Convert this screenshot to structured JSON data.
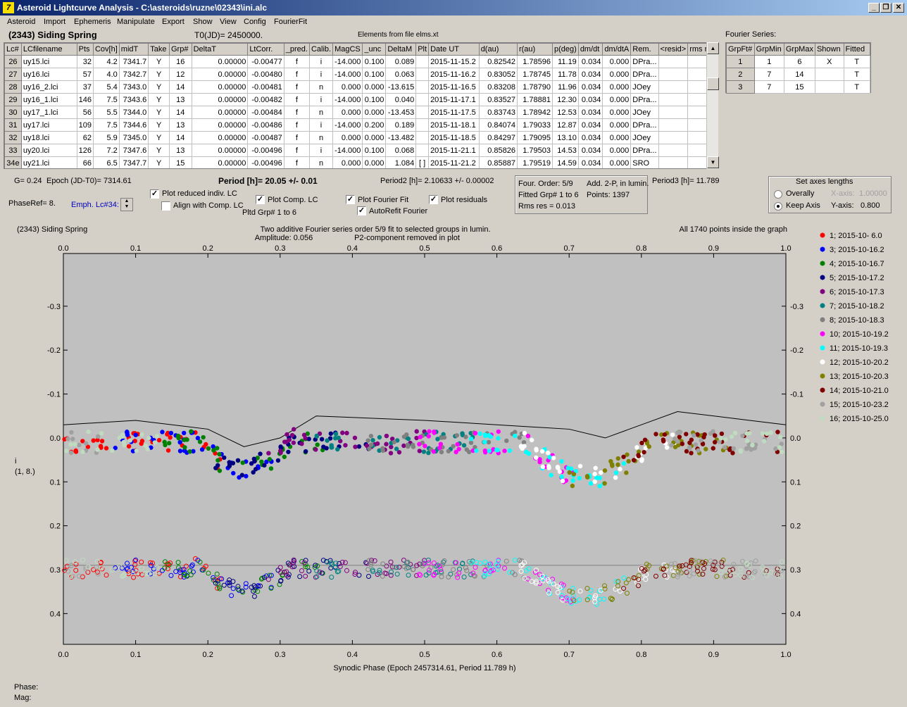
{
  "window": {
    "title": "Asteroid Lightcurve Analysis - C:\\asteroids\\ruzne\\02343\\ini.alc",
    "app_icon": "7"
  },
  "menu": [
    "Asteroid",
    "Import",
    "Ephemeris",
    "Manipulate",
    "Export",
    "Show",
    "View",
    "Config",
    "FourierFit"
  ],
  "header": {
    "object_name": "(2343) Siding Spring",
    "t0": "T0(JD)= 2450000.",
    "elements": "Elements from file elms.xt"
  },
  "table": {
    "columns": [
      "Lc#",
      "LCfilename",
      "Pts",
      "Cov[h]",
      "midT",
      "Take",
      "Grp#",
      "DeltaT",
      "LtCorr.",
      "_pred.",
      "Calib.",
      "MagCS",
      "_unc",
      "DeltaM",
      "Plt",
      "Date UT",
      "d(au)",
      "r(au)",
      "p(deg)",
      "dm/dt",
      "dm/dtA",
      "Rem.",
      "<resid>",
      "rms res"
    ],
    "rows": [
      [
        "26",
        "uy15.lci",
        "32",
        "4.2",
        "7341.7",
        "Y",
        "16",
        "0.00000",
        "-0.00477",
        "f",
        "i",
        "-14.000",
        "0.100",
        "0.089",
        "",
        "2015-11-15.2",
        "0.82542",
        "1.78596",
        "11.19",
        "0.034",
        "0.000",
        "DPra...",
        "",
        ""
      ],
      [
        "27",
        "uy16.lci",
        "57",
        "4.0",
        "7342.7",
        "Y",
        "12",
        "0.00000",
        "-0.00480",
        "f",
        "i",
        "-14.000",
        "0.100",
        "0.063",
        "",
        "2015-11-16.2",
        "0.83052",
        "1.78745",
        "11.78",
        "0.034",
        "0.000",
        "DPra...",
        "",
        ""
      ],
      [
        "28",
        "uy16_2.lci",
        "37",
        "5.4",
        "7343.0",
        "Y",
        "14",
        "0.00000",
        "-0.00481",
        "f",
        "n",
        "0.000",
        "0.000",
        "-13.615",
        "",
        "2015-11-16.5",
        "0.83208",
        "1.78790",
        "11.96",
        "0.034",
        "0.000",
        "JOey",
        "",
        ""
      ],
      [
        "29",
        "uy16_1.lci",
        "146",
        "7.5",
        "7343.6",
        "Y",
        "13",
        "0.00000",
        "-0.00482",
        "f",
        "i",
        "-14.000",
        "0.100",
        "0.040",
        "",
        "2015-11-17.1",
        "0.83527",
        "1.78881",
        "12.30",
        "0.034",
        "0.000",
        "DPra...",
        "",
        ""
      ],
      [
        "30",
        "uy17_1.lci",
        "56",
        "5.5",
        "7344.0",
        "Y",
        "14",
        "0.00000",
        "-0.00484",
        "f",
        "n",
        "0.000",
        "0.000",
        "-13.453",
        "",
        "2015-11-17.5",
        "0.83743",
        "1.78942",
        "12.53",
        "0.034",
        "0.000",
        "JOey",
        "",
        ""
      ],
      [
        "31",
        "uy17.lci",
        "109",
        "7.5",
        "7344.6",
        "Y",
        "13",
        "0.00000",
        "-0.00486",
        "f",
        "i",
        "-14.000",
        "0.200",
        "0.189",
        "",
        "2015-11-18.1",
        "0.84074",
        "1.79033",
        "12.87",
        "0.034",
        "0.000",
        "DPra...",
        "",
        ""
      ],
      [
        "32",
        "uy18.lci",
        "62",
        "5.9",
        "7345.0",
        "Y",
        "14",
        "0.00000",
        "-0.00487",
        "f",
        "n",
        "0.000",
        "0.000",
        "-13.482",
        "",
        "2015-11-18.5",
        "0.84297",
        "1.79095",
        "13.10",
        "0.034",
        "0.000",
        "JOey",
        "",
        ""
      ],
      [
        "33",
        "uy20.lci",
        "126",
        "7.2",
        "7347.6",
        "Y",
        "13",
        "0.00000",
        "-0.00496",
        "f",
        "i",
        "-14.000",
        "0.100",
        "0.068",
        "",
        "2015-11-21.1",
        "0.85826",
        "1.79503",
        "14.53",
        "0.034",
        "0.000",
        "DPra...",
        "",
        ""
      ],
      [
        "34e",
        "uy21.lci",
        "66",
        "6.5",
        "7347.7",
        "Y",
        "15",
        "0.00000",
        "-0.00496",
        "f",
        "n",
        "0.000",
        "0.000",
        "1.084",
        "[ ]",
        "2015-11-21.2",
        "0.85887",
        "1.79519",
        "14.59",
        "0.034",
        "0.000",
        "SRO",
        "",
        ""
      ]
    ]
  },
  "fourier_table": {
    "title": "Fourier Series:",
    "columns": [
      "GrpFt#",
      "GrpMin",
      "GrpMax",
      "Shown",
      "Fitted"
    ],
    "rows": [
      [
        "1",
        "1",
        "6",
        "X",
        "T"
      ],
      [
        "2",
        "7",
        "14",
        "",
        "T"
      ],
      [
        "3",
        "7",
        "15",
        "",
        "T"
      ]
    ]
  },
  "info": {
    "g": "G= 0.24",
    "epoch": "Epoch (JD-T0)= 7314.61",
    "period": "Period [h]= 20.05 +/- 0.01",
    "period2": "Period2 [h]= 2.10633 +/- 0.00002",
    "period3": "Period3 [h]= 11.789",
    "phaseref": "PhaseRef= 8.",
    "emph": "Emph. Lc#34:",
    "plot_reduced": "Plot reduced indiv. LC",
    "align_comp": "Align with Comp. LC",
    "plot_comp": "Plot Comp. LC",
    "pltd_grp": "Pltd Grp#  1   to   6",
    "plot_fourier": "Plot Fourier Fit",
    "autorefit": "AutoRefit Fourier",
    "plot_resid": "Plot residuals",
    "four_order": "Four. Order:  5/9",
    "add2p": "Add. 2-P, in lumin.",
    "fitted_grp": "Fitted Grp# 1 to 6",
    "points": "Points: 1397",
    "rms": "Rms res     = 0.013"
  },
  "axes_box": {
    "title": "Set axes lengths",
    "overally": "Overally",
    "keep": "Keep Axis",
    "xaxis_label": "X-axis:",
    "xaxis_value": "1.00000",
    "yaxis_label": "Y-axis:",
    "yaxis_value": "0.800"
  },
  "plot": {
    "title_left": "(2343) Siding Spring",
    "title_center1": "Two additive Fourier series order 5/9 fit to selected groups in lumin.",
    "title_center2a": "Amplitude: 0.056",
    "title_center2b": "P2-component removed in plot",
    "title_right": "All 1740 points inside the graph",
    "ylabel1": "i",
    "ylabel2": "(1, 8.)",
    "xlabel": "Synodic Phase (Epoch 2457314.61, Period 11.789 h)",
    "bg_color": "#c0c0c0"
  },
  "chart_data": {
    "type": "scatter",
    "xlim": [
      0.0,
      1.0
    ],
    "ylim": [
      -0.42,
      0.47
    ],
    "y_inverted": true,
    "x_ticks": [
      "0.0",
      "0.1",
      "0.2",
      "0.3",
      "0.4",
      "0.5",
      "0.6",
      "0.7",
      "0.8",
      "0.9",
      "1.0"
    ],
    "y_ticks": [
      "-0.3",
      "-0.2",
      "-0.1",
      "0.0",
      "0.1",
      "0.2",
      "0.3",
      "0.4"
    ],
    "series": [
      {
        "name": "1; 2015-10- 6.0",
        "color": "#ff0000"
      },
      {
        "name": "3; 2015-10-16.2",
        "color": "#0000ff"
      },
      {
        "name": "4; 2015-10-16.7",
        "color": "#008000"
      },
      {
        "name": "5; 2015-10-17.2",
        "color": "#000080"
      },
      {
        "name": "6; 2015-10-17.3",
        "color": "#800080"
      },
      {
        "name": "7; 2015-10-18.2",
        "color": "#008080"
      },
      {
        "name": "8; 2015-10-18.3",
        "color": "#808080"
      },
      {
        "name": "10; 2015-10-19.2",
        "color": "#ff00ff"
      },
      {
        "name": "11; 2015-10-19.3",
        "color": "#00ffff"
      },
      {
        "name": "12; 2015-10-20.2",
        "color": "#ffffff"
      },
      {
        "name": "13; 2015-10-20.3",
        "color": "#808000"
      },
      {
        "name": "14; 2015-10-21.0",
        "color": "#800000"
      },
      {
        "name": "15; 2015-10-23.2",
        "color": "#a0a0a0"
      },
      {
        "name": "16; 2015-10-25.0",
        "color": "#c0dcc0"
      }
    ],
    "curve_top": [
      [
        0.0,
        0.03
      ],
      [
        0.1,
        0.02
      ],
      [
        0.2,
        0.04
      ],
      [
        0.25,
        0.08
      ],
      [
        0.3,
        0.06
      ],
      [
        0.35,
        0.01
      ],
      [
        0.5,
        0.02
      ],
      [
        0.6,
        0.03
      ],
      [
        0.7,
        0.04
      ],
      [
        0.75,
        0.06
      ],
      [
        0.8,
        0.03
      ],
      [
        0.85,
        0.0
      ],
      [
        0.95,
        0.02
      ],
      [
        1.0,
        0.03
      ]
    ],
    "resid_offset": 0.29
  },
  "status": {
    "phase": "Phase:",
    "mag": "Mag:"
  }
}
